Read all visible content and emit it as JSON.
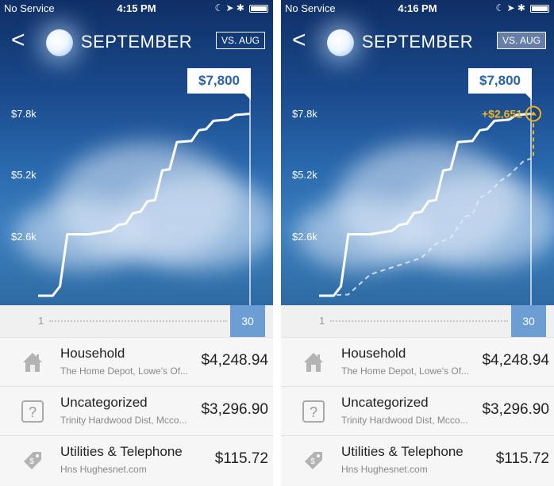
{
  "screens": [
    {
      "status": {
        "carrier": "No Service",
        "time": "4:15 PM"
      },
      "nav": {
        "back": "<",
        "title": "SEPTEMBER",
        "compare": "VS. AUG"
      },
      "y_labels": [
        "$7.8k",
        "$5.2k",
        "$2.6k"
      ],
      "total": "$7,800",
      "diff_label": "",
      "timeline": {
        "start": "1",
        "end": "30"
      }
    },
    {
      "status": {
        "carrier": "No Service",
        "time": "4:16 PM"
      },
      "nav": {
        "back": "<",
        "title": "SEPTEMBER",
        "compare": "VS. AUG"
      },
      "y_labels": [
        "$7.8k",
        "$5.2k",
        "$2.6k"
      ],
      "total": "$7,800",
      "diff_label": "+$2,651",
      "timeline": {
        "start": "1",
        "end": "30"
      }
    }
  ],
  "categories": [
    {
      "name": "Household",
      "merchants": "The Home Depot, Lowe's Of...",
      "amount": "$4,248.94",
      "icon": "house-icon"
    },
    {
      "name": "Uncategorized",
      "merchants": "Trinity Hardwood Dist, Mcco...",
      "amount": "$3,296.90",
      "icon": "question-icon"
    },
    {
      "name": "Utilities & Telephone",
      "merchants": "Hns Hughesnet.com",
      "amount": "$115.72",
      "icon": "price-tag-icon"
    }
  ],
  "colors": {
    "accent": "#6c9ed3",
    "highlight": "#f2b21b",
    "tag_text": "#2b63a8"
  },
  "chart_data": {
    "type": "line",
    "x_range": [
      1,
      30
    ],
    "ylim": [
      0,
      8000
    ],
    "y_ticks": [
      "$2.6k",
      "$5.2k",
      "$7.8k"
    ],
    "series": [
      {
        "values": [
          [
            1,
            0
          ],
          [
            3,
            0
          ],
          [
            4,
            400
          ],
          [
            5,
            2600
          ],
          [
            8,
            2600
          ],
          [
            9,
            2650
          ],
          [
            11,
            2750
          ],
          [
            12,
            3000
          ],
          [
            13,
            3050
          ],
          [
            14,
            3500
          ],
          [
            15,
            3550
          ],
          [
            16,
            4000
          ],
          [
            17,
            4050
          ],
          [
            18,
            5300
          ],
          [
            19,
            5350
          ],
          [
            20,
            6500
          ],
          [
            22,
            6550
          ],
          [
            23,
            7000
          ],
          [
            24,
            7050
          ],
          [
            25,
            7400
          ],
          [
            27,
            7450
          ],
          [
            28,
            7650
          ],
          [
            30,
            7700
          ]
        ]
      },
      {
        "values": [
          [
            1,
            0
          ],
          [
            5,
            50
          ],
          [
            8,
            900
          ],
          [
            10,
            1100
          ],
          [
            13,
            1400
          ],
          [
            15,
            1600
          ],
          [
            17,
            2200
          ],
          [
            19,
            2450
          ],
          [
            21,
            3350
          ],
          [
            22,
            3450
          ],
          [
            23,
            4150
          ],
          [
            24,
            4300
          ],
          [
            26,
            4900
          ],
          [
            27,
            5100
          ],
          [
            29,
            5700
          ],
          [
            30,
            5800
          ]
        ]
      }
    ]
  }
}
